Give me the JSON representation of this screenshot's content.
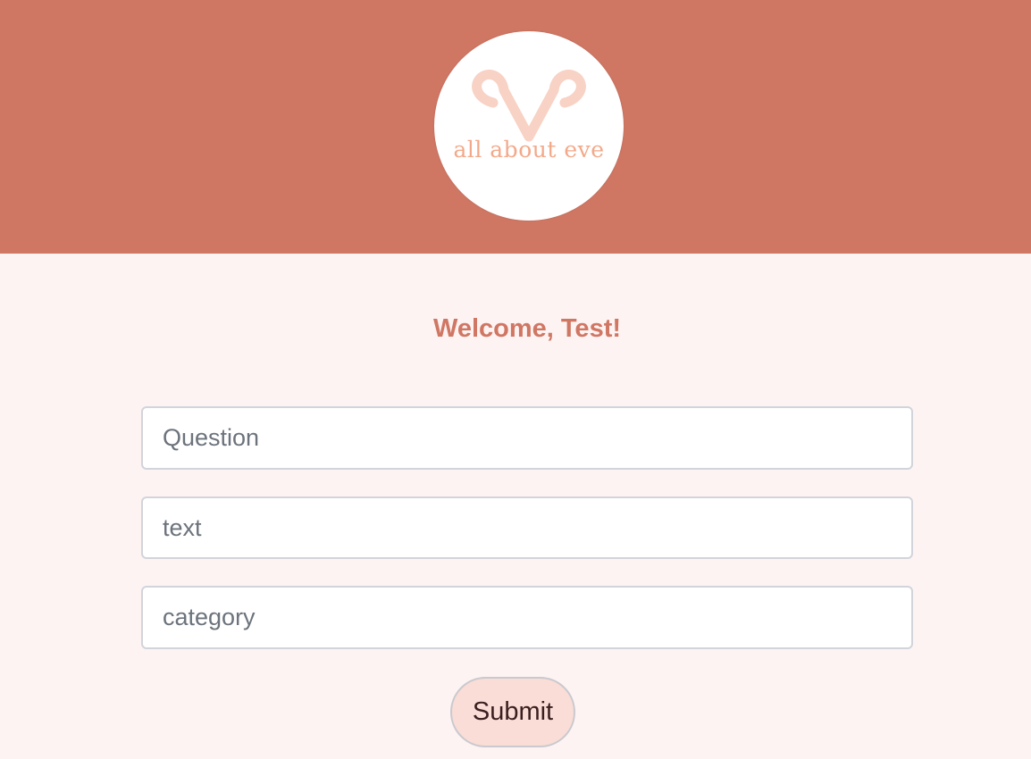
{
  "brand": {
    "logo_text": "all about eve",
    "header_color": "#d07764",
    "logo_accent": "#f3a989"
  },
  "welcome": {
    "message": "Welcome, Test!"
  },
  "form": {
    "fields": [
      {
        "placeholder": "Question",
        "value": ""
      },
      {
        "placeholder": "text",
        "value": ""
      },
      {
        "placeholder": "category",
        "value": ""
      }
    ],
    "submit_label": "Submit"
  }
}
